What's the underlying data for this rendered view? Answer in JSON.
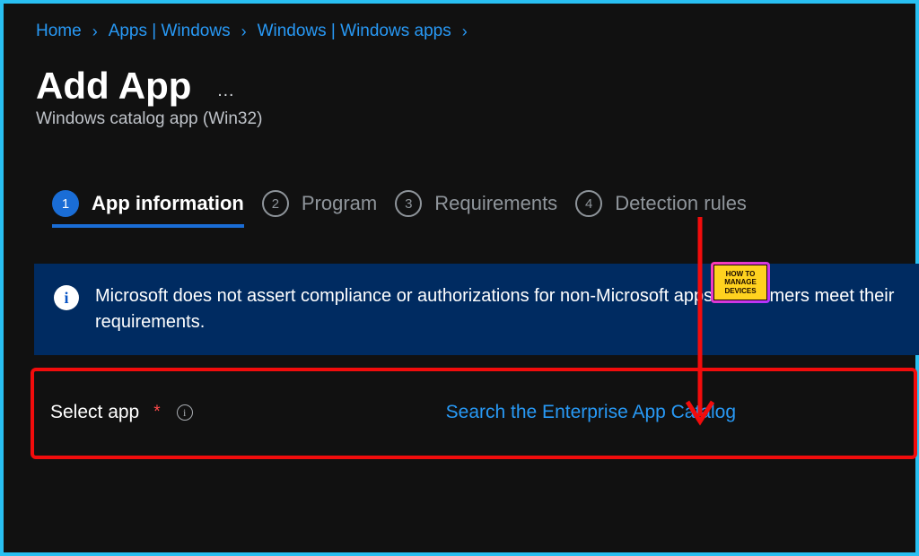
{
  "breadcrumb": {
    "home": "Home",
    "apps": "Apps | Windows",
    "windows": "Windows | Windows apps"
  },
  "page": {
    "title": "Add App",
    "subtitle": "Windows catalog app (Win32)",
    "more": "…"
  },
  "tabs": {
    "t1": {
      "num": "1",
      "label": "App information"
    },
    "t2": {
      "num": "2",
      "label": "Program"
    },
    "t3": {
      "num": "3",
      "label": "Requirements"
    },
    "t4": {
      "num": "4",
      "label": "Detection rules"
    }
  },
  "banner": {
    "icon": "i",
    "text": "Microsoft does not assert compliance or authorizations for non-Microsoft apps. Customers meet their requirements."
  },
  "select": {
    "label": "Select app",
    "star": "*",
    "hint_icon": "i",
    "link": "Search the Enterprise App Catalog"
  },
  "badge": {
    "line1": "HOW TO",
    "line2": "MANAGE",
    "line3": "DEVICES"
  }
}
